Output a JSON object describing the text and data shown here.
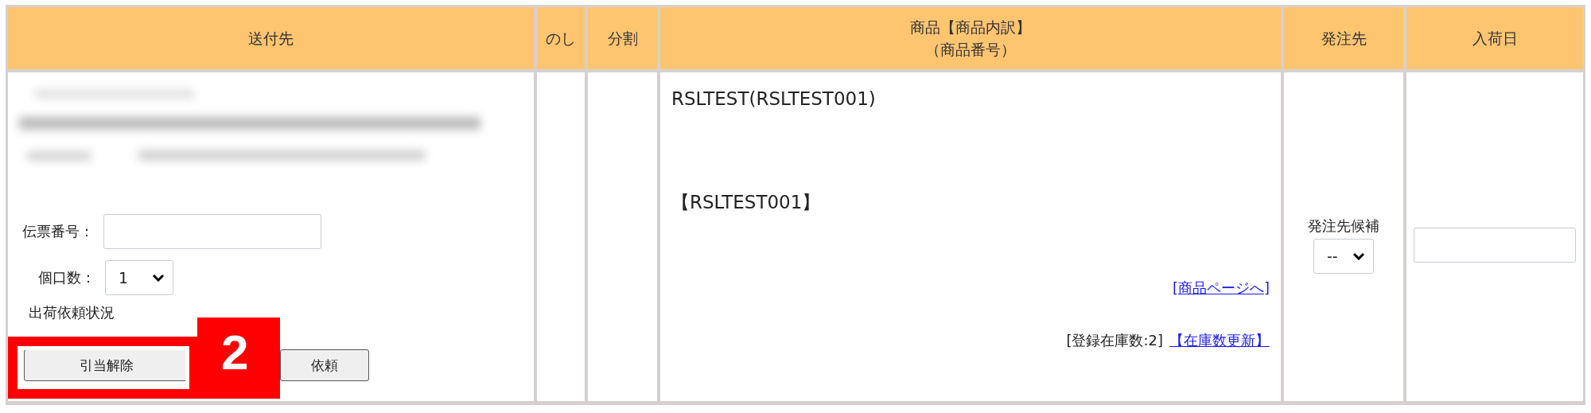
{
  "table": {
    "columns": [
      {
        "label": "送付先"
      },
      {
        "label": "のし"
      },
      {
        "label": "分割"
      },
      {
        "label": "商品【商品内訳】",
        "sublabel": "（商品番号）"
      },
      {
        "label": "発注先"
      },
      {
        "label": "入荷日"
      }
    ],
    "row": {
      "slip_number": {
        "label": "伝票番号："
      },
      "packages": {
        "label": "個口数：",
        "value": "1"
      },
      "shipping_status": "出荷依頼状況",
      "buttons": [
        "引当解除",
        "依頼"
      ],
      "product": {
        "name": "RSLTEST(RSLTEST001)",
        "code": "【RSLTEST001】",
        "page_link": "[商品ページへ]",
        "stock": "[登録在庫数:2]",
        "stock_update_link": "【在庫数更新】"
      },
      "supplier": {
        "label": "発注先候補",
        "value": "--"
      }
    }
  },
  "annotation": {
    "label": "2"
  }
}
